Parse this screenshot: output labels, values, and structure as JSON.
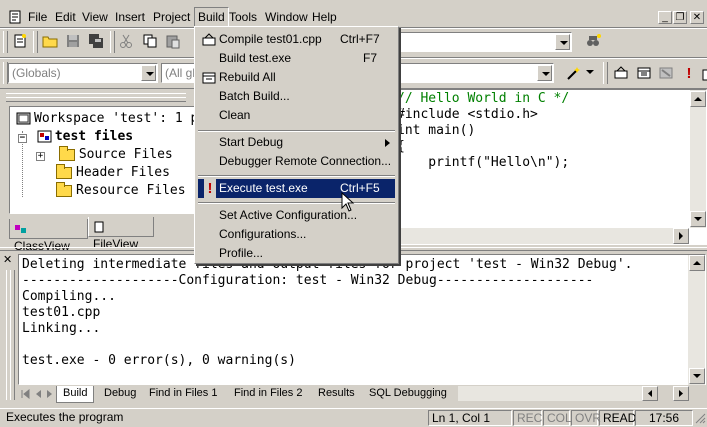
{
  "menubar": {
    "items": [
      "File",
      "Edit",
      "View",
      "Insert",
      "Project",
      "Build",
      "Tools",
      "Window",
      "Help"
    ]
  },
  "toolbar": {
    "globals_combo": "(Globals)",
    "members_combo": "(All global members)",
    "function_combo": ""
  },
  "workspace": {
    "title": "Workspace 'test': 1 project(s)",
    "project": "test files",
    "folders": [
      "Source Files",
      "Header Files",
      "Resource Files"
    ],
    "tabs": [
      "ClassView",
      "FileView"
    ]
  },
  "editor": {
    "lines": [
      "// Hello World in C */",
      "#include <stdio.h>",
      "int main()",
      "{",
      "    printf(\"Hello\\n\");",
      "}"
    ]
  },
  "build_menu": {
    "compile": "Compile test01.cpp",
    "compile_key": "Ctrl+F7",
    "build": "Build test.exe",
    "build_key": "F7",
    "rebuild": "Rebuild All",
    "batch": "Batch Build...",
    "clean": "Clean",
    "start_debug": "Start Debug",
    "remote": "Debugger Remote Connection...",
    "execute": "Execute test.exe",
    "execute_key": "Ctrl+F5",
    "set_active": "Set Active Configuration...",
    "configurations": "Configurations...",
    "profile": "Profile..."
  },
  "output": {
    "lines": [
      "Deleting intermediate files and output files for project 'test - Win32 Debug'.",
      "--------------------Configuration: test - Win32 Debug--------------------",
      "Compiling...",
      "test01.cpp",
      "Linking...",
      "",
      "test.exe - 0 error(s), 0 warning(s)"
    ],
    "tabs": [
      "Build",
      "Debug",
      "Find in Files 1",
      "Find in Files 2",
      "Results",
      "SQL Debugging"
    ]
  },
  "status": {
    "message": "Executes the program",
    "position": "Ln 1, Col 1",
    "rec": "REC",
    "col": "COL",
    "ovr": "OVR",
    "read": "READ",
    "time": "17:56"
  },
  "colors": {
    "menu_highlight": "#0a246a",
    "face": "#d4d0c8"
  }
}
